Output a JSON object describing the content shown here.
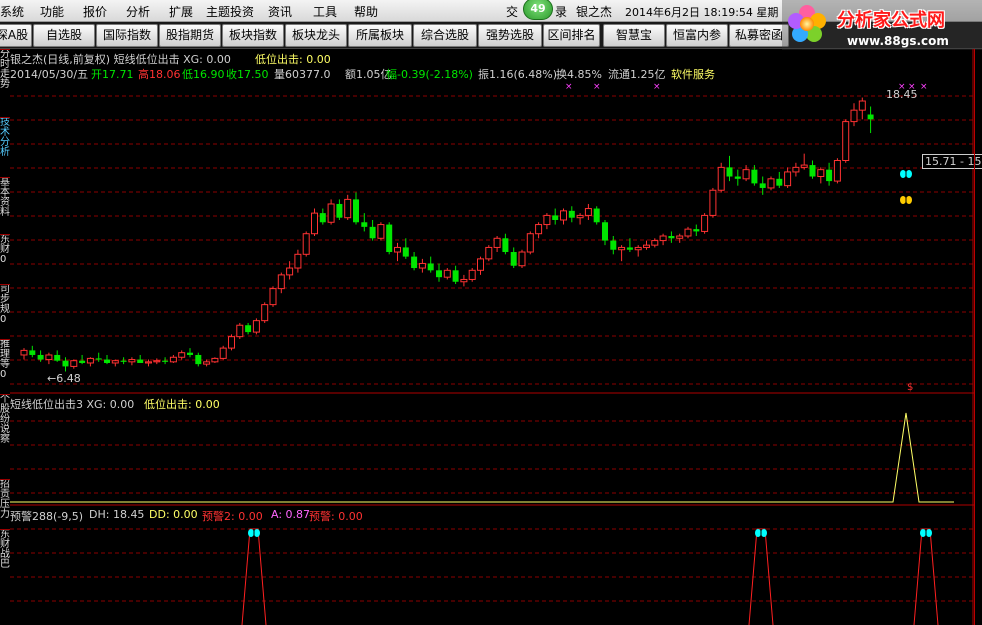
{
  "menu": {
    "items": [
      "系统",
      "功能",
      "报价",
      "分析",
      "扩展",
      "主题投资",
      "资讯",
      "工具",
      "帮助"
    ],
    "trade_label": "交",
    "login_label": "录",
    "stock_name": "银之杰",
    "datetime": "2014年6月2日  18:19:54 星期",
    "notify_count": "49"
  },
  "toolbar": {
    "buttons": [
      "深A股",
      "自选股",
      "国际指数",
      "股指期货",
      "板块指数",
      "板块龙头",
      "所属板块",
      "综合选股",
      "强势选股",
      "区间排名",
      "智慧宝",
      "恒富内参",
      "私募密函"
    ]
  },
  "logo": {
    "title": "分析家公式网",
    "url_text": "www.88gs.com"
  },
  "sidebar": {
    "tabs": [
      "分时走势",
      "技术分析",
      "基本资料",
      "东财0",
      "司步规0",
      "推理等0",
      "个股纷说察",
      "招贡压力",
      "东财战巴"
    ]
  },
  "main_panel": {
    "title_line": "银之杰(日线,前复权) 短线低位出击 XG: 0.00",
    "signal_label": "低位出击: 0.00",
    "date": "2014/05/30/五",
    "open": "开17.71",
    "high": "高18.06",
    "low": "低16.90",
    "close": "收17.50",
    "volume": "量60377.0",
    "amount": "额1.05亿",
    "change": "幅-0.39(-2.18%)",
    "amplitude": "振1.16(6.48%)",
    "turnover": "换4.85%",
    "float_shares": "流通1.25亿",
    "software": "软件服务",
    "price_high_label": "18.45",
    "price_low_label": "←6.48",
    "price_box": "15.71 - 15"
  },
  "sub_panel_1": {
    "title": "短线低位出击3 XG: 0.00",
    "signal": "低位出击: 0.00"
  },
  "sub_panel_2": {
    "title": "预警288(-9,5)",
    "dh": "DH: 18.45",
    "dd": "DD: 0.00",
    "warn2": "预警2: 0.00",
    "a": "A: 0.87",
    "warn": "预警: 0.00"
  },
  "colors": {
    "up": "#ff3232",
    "down": "#00e600",
    "grid": "#8b0000",
    "yellow": "#ffff66",
    "cyan": "#00ffff",
    "accent_logo": "#ff0000"
  },
  "chart_data": {
    "type": "candlestick",
    "description_ohlc": "sequential daily candles, open/high/low/close",
    "candles": [
      [
        7.2,
        7.5,
        7.0,
        7.4
      ],
      [
        7.4,
        7.6,
        7.1,
        7.2
      ],
      [
        7.2,
        7.4,
        6.9,
        7.0
      ],
      [
        7.0,
        7.3,
        6.8,
        7.2
      ],
      [
        7.2,
        7.4,
        6.9,
        6.95
      ],
      [
        6.95,
        7.1,
        6.48,
        6.7
      ],
      [
        6.7,
        7.0,
        6.6,
        6.95
      ],
      [
        6.95,
        7.2,
        6.8,
        6.85
      ],
      [
        6.85,
        7.1,
        6.7,
        7.05
      ],
      [
        7.05,
        7.3,
        6.9,
        7.0
      ],
      [
        7.0,
        7.2,
        6.8,
        6.85
      ],
      [
        6.85,
        7.0,
        6.7,
        6.95
      ],
      [
        6.95,
        7.1,
        6.8,
        6.9
      ],
      [
        6.9,
        7.1,
        6.75,
        7.0
      ],
      [
        7.0,
        7.2,
        6.9,
        6.85
      ],
      [
        6.85,
        7.0,
        6.7,
        6.9
      ],
      [
        6.9,
        7.05,
        6.8,
        6.95
      ],
      [
        6.95,
        7.1,
        6.8,
        6.9
      ],
      [
        6.9,
        7.2,
        6.85,
        7.1
      ],
      [
        7.1,
        7.4,
        7.0,
        7.3
      ],
      [
        7.3,
        7.5,
        7.1,
        7.2
      ],
      [
        7.2,
        7.3,
        6.7,
        6.8
      ],
      [
        6.8,
        7.0,
        6.7,
        6.9
      ],
      [
        6.9,
        7.1,
        6.85,
        7.05
      ],
      [
        7.05,
        7.6,
        7.0,
        7.5
      ],
      [
        7.5,
        8.1,
        7.4,
        8.0
      ],
      [
        8.0,
        8.6,
        7.9,
        8.5
      ],
      [
        8.5,
        8.6,
        8.1,
        8.2
      ],
      [
        8.2,
        8.8,
        8.1,
        8.7
      ],
      [
        8.7,
        9.5,
        8.6,
        9.4
      ],
      [
        9.4,
        10.2,
        9.3,
        10.1
      ],
      [
        10.1,
        10.8,
        9.9,
        10.7
      ],
      [
        10.7,
        11.3,
        10.5,
        11.0
      ],
      [
        11.0,
        11.8,
        10.8,
        11.6
      ],
      [
        11.6,
        12.6,
        11.5,
        12.5
      ],
      [
        12.5,
        13.6,
        12.4,
        13.4
      ],
      [
        13.4,
        13.6,
        12.9,
        13.0
      ],
      [
        13.0,
        14.0,
        12.9,
        13.8
      ],
      [
        13.8,
        14.0,
        13.1,
        13.2
      ],
      [
        13.2,
        14.2,
        13.1,
        14.0
      ],
      [
        14.0,
        14.3,
        12.9,
        13.0
      ],
      [
        13.0,
        13.4,
        12.6,
        12.8
      ],
      [
        12.8,
        13.1,
        12.2,
        12.3
      ],
      [
        12.3,
        13.0,
        12.2,
        12.9
      ],
      [
        12.9,
        13.0,
        11.6,
        11.7
      ],
      [
        11.7,
        12.1,
        11.3,
        11.9
      ],
      [
        11.9,
        12.3,
        11.4,
        11.5
      ],
      [
        11.5,
        11.7,
        10.9,
        11.0
      ],
      [
        11.0,
        11.4,
        10.8,
        11.2
      ],
      [
        11.2,
        11.5,
        10.8,
        10.9
      ],
      [
        10.9,
        11.2,
        10.4,
        10.6
      ],
      [
        10.6,
        11.0,
        10.5,
        10.9
      ],
      [
        10.9,
        11.1,
        10.3,
        10.4
      ],
      [
        10.4,
        10.7,
        10.2,
        10.5
      ],
      [
        10.5,
        11.0,
        10.4,
        10.9
      ],
      [
        10.9,
        11.5,
        10.7,
        11.4
      ],
      [
        11.4,
        12.0,
        11.3,
        11.9
      ],
      [
        11.9,
        12.4,
        11.7,
        12.3
      ],
      [
        12.3,
        12.5,
        11.6,
        11.7
      ],
      [
        11.7,
        11.9,
        11.0,
        11.1
      ],
      [
        11.1,
        11.8,
        11.0,
        11.7
      ],
      [
        11.7,
        12.6,
        11.6,
        12.5
      ],
      [
        12.5,
        13.0,
        12.3,
        12.9
      ],
      [
        12.9,
        13.4,
        12.7,
        13.3
      ],
      [
        13.3,
        13.6,
        12.9,
        13.1
      ],
      [
        13.1,
        13.6,
        12.9,
        13.5
      ],
      [
        13.5,
        13.7,
        13.0,
        13.2
      ],
      [
        13.2,
        13.4,
        12.9,
        13.3
      ],
      [
        13.3,
        13.8,
        13.1,
        13.6
      ],
      [
        13.6,
        13.7,
        12.9,
        13.0
      ],
      [
        13.0,
        13.1,
        12.0,
        12.2
      ],
      [
        12.2,
        12.4,
        11.6,
        11.8
      ],
      [
        11.8,
        12.0,
        11.3,
        11.9
      ],
      [
        11.9,
        12.3,
        11.7,
        11.8
      ],
      [
        11.8,
        12.0,
        11.5,
        11.9
      ],
      [
        11.9,
        12.2,
        11.8,
        12.0
      ],
      [
        12.0,
        12.3,
        11.9,
        12.2
      ],
      [
        12.2,
        12.5,
        12.0,
        12.4
      ],
      [
        12.4,
        12.6,
        12.1,
        12.3
      ],
      [
        12.3,
        12.5,
        12.1,
        12.4
      ],
      [
        12.4,
        12.8,
        12.3,
        12.7
      ],
      [
        12.7,
        12.9,
        12.4,
        12.6
      ],
      [
        12.6,
        13.4,
        12.5,
        13.3
      ],
      [
        13.3,
        14.5,
        13.2,
        14.4
      ],
      [
        14.4,
        15.6,
        14.3,
        15.4
      ],
      [
        15.4,
        15.9,
        14.8,
        15.0
      ],
      [
        15.0,
        15.3,
        14.6,
        14.9
      ],
      [
        14.9,
        15.5,
        14.8,
        15.3
      ],
      [
        15.3,
        15.5,
        14.6,
        14.7
      ],
      [
        14.7,
        15.0,
        14.2,
        14.5
      ],
      [
        14.5,
        15.0,
        14.4,
        14.9
      ],
      [
        14.9,
        15.2,
        14.5,
        14.6
      ],
      [
        14.6,
        15.4,
        14.5,
        15.2
      ],
      [
        15.2,
        15.6,
        15.0,
        15.4
      ],
      [
        15.4,
        16.0,
        15.3,
        15.5
      ],
      [
        15.5,
        15.7,
        14.9,
        15.0
      ],
      [
        15.0,
        15.4,
        14.7,
        15.3
      ],
      [
        15.3,
        15.6,
        14.6,
        14.8
      ],
      [
        14.8,
        15.8,
        14.7,
        15.7
      ],
      [
        15.7,
        17.5,
        15.6,
        17.4
      ],
      [
        17.4,
        18.2,
        17.2,
        17.9
      ],
      [
        17.9,
        18.45,
        17.5,
        18.3
      ],
      [
        17.71,
        18.06,
        16.9,
        17.5
      ]
    ]
  }
}
